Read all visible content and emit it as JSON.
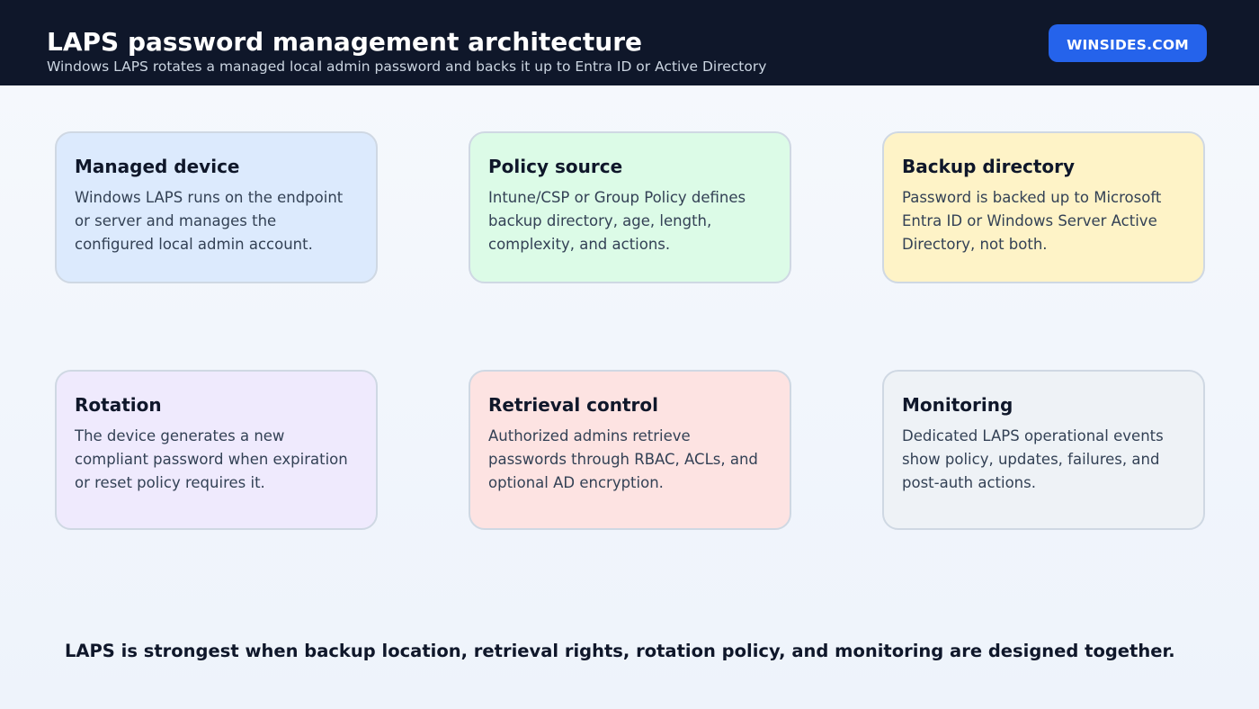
{
  "header": {
    "title": "LAPS password management architecture",
    "subtitle": "Windows LAPS rotates a managed local admin password and backs it up to Entra ID or Active Directory",
    "brand": "WINSIDES.COM"
  },
  "cards": [
    {
      "title": "Managed device",
      "body": "Windows LAPS runs on the endpoint or server and manages the configured local admin account.",
      "color": "#dceafd"
    },
    {
      "title": "Policy source",
      "body": "Intune/CSP or Group Policy defines backup directory, age, length, complexity, and actions.",
      "color": "#dcfbe7"
    },
    {
      "title": "Backup directory",
      "body": "Password is backed up to Microsoft Entra ID or Windows Server Active Directory, not both.",
      "color": "#fef3c7"
    },
    {
      "title": "Rotation",
      "body": "The device generates a new compliant password when expiration or reset policy requires it.",
      "color": "#efeafd"
    },
    {
      "title": "Retrieval control",
      "body": "Authorized admins retrieve passwords through RBAC, ACLs, and optional AD encryption.",
      "color": "#fde3e2"
    },
    {
      "title": "Monitoring",
      "body": "Dedicated LAPS operational events show policy, updates, failures, and post-auth actions.",
      "color": "#eef2f6"
    }
  ],
  "footer": "LAPS is strongest when backup location, retrieval rights, rotation policy, and monitoring are designed together.",
  "colors": {
    "header_bg": "#0f172a",
    "brand_bg": "#2563eb",
    "card_border": "#cfd8e3"
  }
}
